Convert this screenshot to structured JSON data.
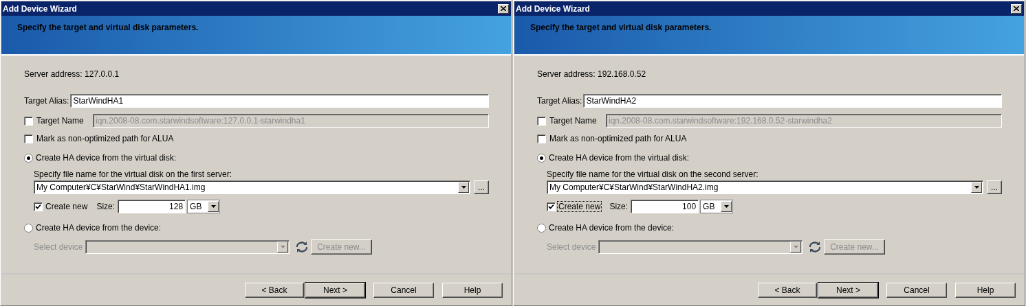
{
  "dialogs": [
    {
      "title": "Add Device Wizard",
      "header": "Specify the target and virtual disk parameters.",
      "server_address": "Server address: 127.0.0.1",
      "alias_label": "Target Alias:",
      "alias_value": "StarWindHA1",
      "target_name": {
        "label": "Target Name",
        "checked": false,
        "value": "iqn.2008-08.com.starwindsoftware:127.0.0.1-starwindha1"
      },
      "alua": {
        "label": "Mark as non-optimized path for ALUA",
        "checked": false
      },
      "options": [
        {
          "label": "Create HA device from the virtual disk:",
          "selected": true
        },
        {
          "label": "Create HA device from the device:",
          "selected": false
        }
      ],
      "file_label": "Specify file name for the virtual disk on the first server:",
      "file_path": "My Computer¥C¥StarWind¥StarWindHA1.img",
      "browse": "...",
      "create_new": {
        "label": "Create new",
        "checked": true,
        "focused": false
      },
      "size_label": "Size:",
      "size_value": "128",
      "size_unit": "GB",
      "device": {
        "label": "Select device",
        "disabled": true,
        "create_button": "Create new..."
      },
      "buttons": [
        {
          "label": "< Back",
          "default": false
        },
        {
          "label": "Next >",
          "default": true
        },
        {
          "label": "Cancel",
          "default": false
        },
        {
          "label": "Help",
          "default": false
        }
      ]
    },
    {
      "title": "Add Device Wizard",
      "header": "Specify the target and virtual disk parameters.",
      "server_address": "Server address: 192.168.0.52",
      "alias_label": "Target Alias:",
      "alias_value": "StarWindHA2",
      "target_name": {
        "label": "Target Name",
        "checked": false,
        "value": "iqn.2008-08.com.starwindsoftware:192.168.0.52-starwindha2"
      },
      "alua": {
        "label": "Mark as non-optimized path for ALUA",
        "checked": false
      },
      "options": [
        {
          "label": "Create HA device from the virtual disk:",
          "selected": true
        },
        {
          "label": "Create HA device from the device:",
          "selected": false
        }
      ],
      "file_label": "Specify file name for the virtual disk on the second server:",
      "file_path": "My Computer¥C¥StarWind¥StarWindHA2.img",
      "browse": "...",
      "create_new": {
        "label": "Create new",
        "checked": true,
        "focused": true
      },
      "size_label": "Size:",
      "size_value": "100",
      "size_unit": "GB",
      "device": {
        "label": "Select device",
        "disabled": true,
        "create_button": "Create new..."
      },
      "buttons": [
        {
          "label": "< Back",
          "default": false
        },
        {
          "label": "Next >",
          "default": true
        },
        {
          "label": "Cancel",
          "default": false
        },
        {
          "label": "Help",
          "default": false
        }
      ]
    }
  ]
}
